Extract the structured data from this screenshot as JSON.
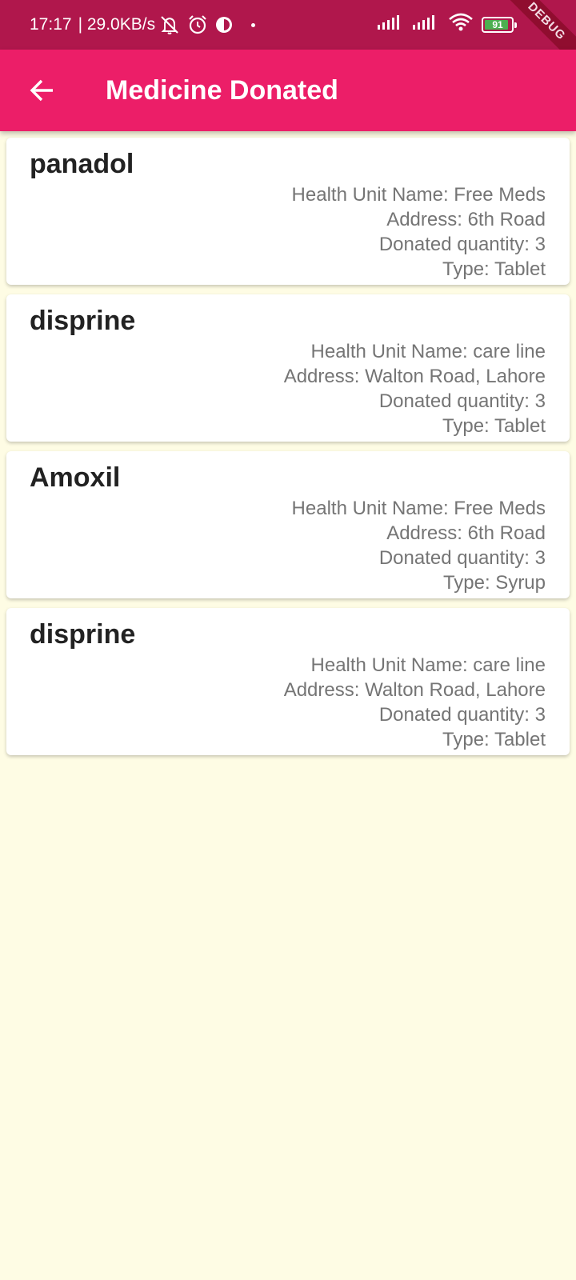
{
  "status_bar": {
    "time": "17:17",
    "network_speed": "| 29.0KB/s",
    "battery_level": "91",
    "icons": [
      "mute-notification-icon",
      "alarm-icon",
      "data-saver-icon",
      "signal-icon",
      "signal-icon",
      "wifi-icon",
      "battery-icon"
    ]
  },
  "debug_banner": "DEBUG",
  "app_bar": {
    "title": "Medicine Donated",
    "back_icon": "arrow-back-icon"
  },
  "colors": {
    "status_bar": "#B0174C",
    "app_bar": "#EC1E68",
    "background": "#FEFCE4",
    "card": "#FFFFFF"
  },
  "donations": [
    {
      "name": "panadol",
      "health_unit": "Health Unit Name: Free Meds",
      "address": "Address: 6th Road",
      "quantity": "Donated quantity: 3",
      "type": "Type: Tablet"
    },
    {
      "name": "disprine",
      "health_unit": "Health Unit Name: care line",
      "address": "Address: Walton Road, Lahore",
      "quantity": "Donated quantity: 3",
      "type": "Type: Tablet"
    },
    {
      "name": "Amoxil",
      "health_unit": "Health Unit Name: Free Meds",
      "address": "Address: 6th Road",
      "quantity": "Donated quantity: 3",
      "type": "Type: Syrup"
    },
    {
      "name": "disprine",
      "health_unit": "Health Unit Name: care line",
      "address": "Address: Walton Road, Lahore",
      "quantity": "Donated quantity: 3",
      "type": "Type: Tablet"
    }
  ]
}
